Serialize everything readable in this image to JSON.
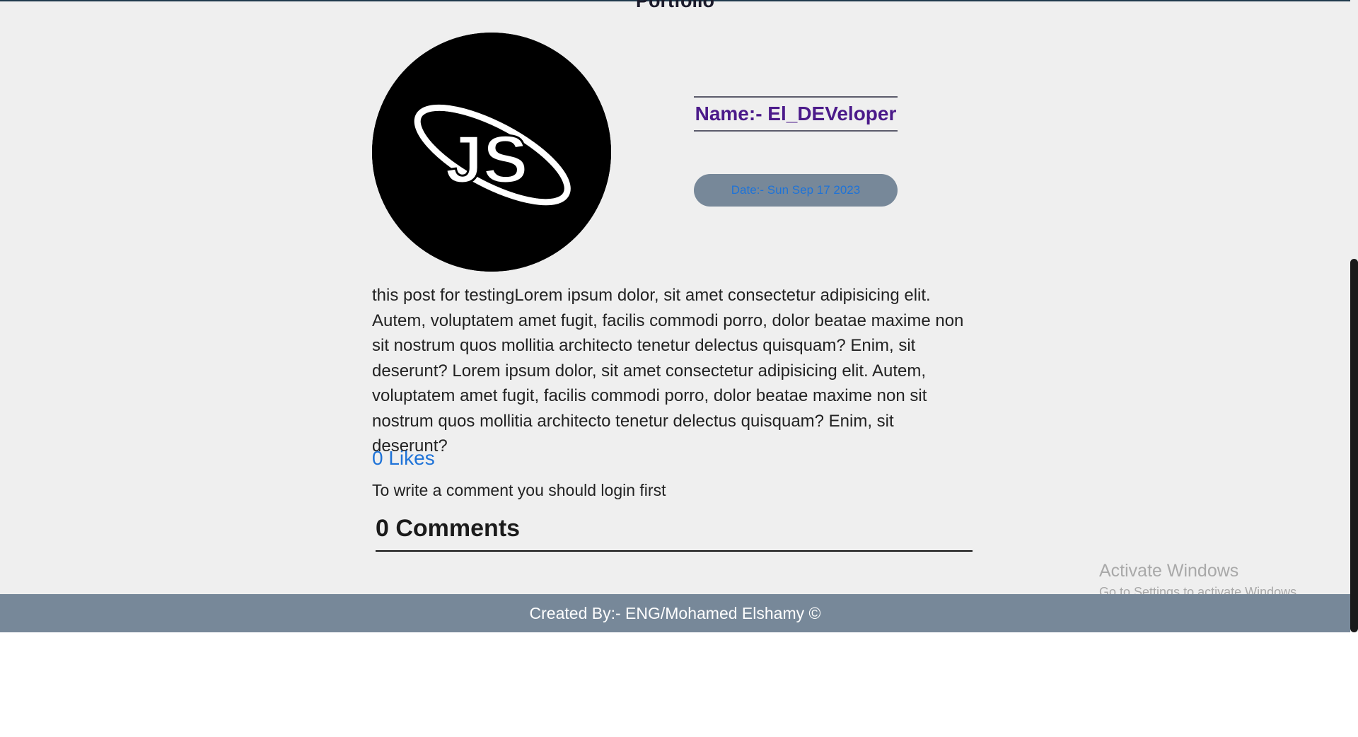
{
  "page": {
    "title": "Portfolio"
  },
  "post": {
    "author_name": "Name:- El_DEVeloper",
    "date": "Date:- Sun Sep 17 2023",
    "body": "this post for testingLorem ipsum dolor, sit amet consectetur adipisicing elit. Autem, voluptatem amet fugit, facilis commodi porro, dolor beatae maxime non sit nostrum quos mollitia architecto tenetur delectus quisquam? Enim, sit deserunt? Lorem ipsum dolor, sit amet consectetur adipisicing elit. Autem, voluptatem amet fugit, facilis commodi porro, dolor beatae maxime non sit nostrum quos mollitia architecto tenetur delectus quisquam? Enim, sit deserunt?",
    "avatar_logo": "JS",
    "likes": "0 Likes",
    "login_note": "To write a comment you should login first",
    "comments_heading": "0 Comments"
  },
  "footer": {
    "text": "Created By:- ENG/Mohamed Elshamy ©"
  },
  "overlay": {
    "activate_title": "Activate Windows",
    "activate_sub": "Go to Settings to activate Windows."
  },
  "colors": {
    "background": "#efefef",
    "footer_bg": "#778899",
    "author_name": "#4b1a8a",
    "link_blue": "#1e73d8",
    "date_pill_bg": "#778899"
  },
  "icons": {
    "avatar": "js-logo-icon"
  }
}
